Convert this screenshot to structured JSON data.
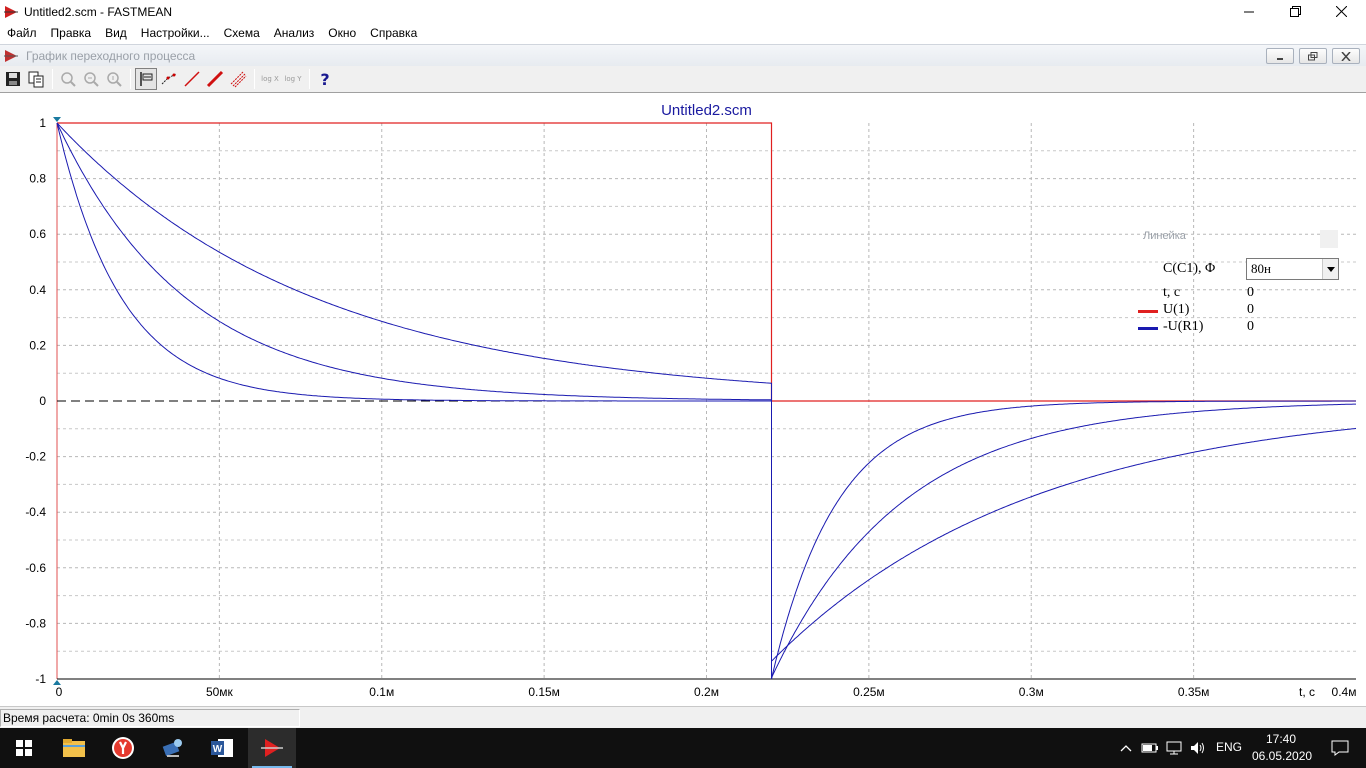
{
  "window": {
    "title": "Untitled2.scm - FASTMEAN"
  },
  "menu": [
    "Файл",
    "Правка",
    "Вид",
    "Настройки...",
    "Схема",
    "Анализ",
    "Окно",
    "Справка"
  ],
  "child_window": {
    "title": "График переходного процесса"
  },
  "toolbar": {
    "log_x": "log X",
    "log_y": "log Y",
    "help": "?"
  },
  "chart_data": {
    "type": "line",
    "title": "Untitled2.scm",
    "xlabel": "t, c",
    "x_unit_note": "seconds",
    "xlim": [
      0,
      0.0004
    ],
    "ylim": [
      -1,
      1
    ],
    "x_ticks": [
      {
        "value": 0,
        "label": "0"
      },
      {
        "value": 5e-05,
        "label": "50мк"
      },
      {
        "value": 0.0001,
        "label": "0.1м"
      },
      {
        "value": 0.00015,
        "label": "0.15м"
      },
      {
        "value": 0.0002,
        "label": "0.2м"
      },
      {
        "value": 0.00025,
        "label": "0.25м"
      },
      {
        "value": 0.0003,
        "label": "0.3м"
      },
      {
        "value": 0.00035,
        "label": "0.35м"
      },
      {
        "value": 0.0004,
        "label": "0.4м"
      }
    ],
    "y_ticks": [
      {
        "value": 1,
        "label": "1"
      },
      {
        "value": 0.8,
        "label": "0.8"
      },
      {
        "value": 0.6,
        "label": "0.6"
      },
      {
        "value": 0.4,
        "label": "0.4"
      },
      {
        "value": 0.2,
        "label": "0.2"
      },
      {
        "value": 0,
        "label": "0"
      },
      {
        "value": -0.2,
        "label": "-0.2"
      },
      {
        "value": -0.4,
        "label": "-0.4"
      },
      {
        "value": -0.6,
        "label": "-0.6"
      },
      {
        "value": -0.8,
        "label": "-0.8"
      },
      {
        "value": -1,
        "label": "-1"
      }
    ],
    "grid": true,
    "series": [
      {
        "name": "U(1)",
        "color": "#e02020",
        "points": [
          [
            0,
            1
          ],
          [
            0.00022,
            1
          ],
          [
            0.00022,
            0
          ],
          [
            0.0004,
            0
          ]
        ]
      },
      {
        "name": "-U(R1)",
        "color": "#1a1ab0",
        "step_time": 0.00022,
        "time_constants": [
          2e-05,
          4e-05,
          8e-05
        ],
        "points_tau_20u": [
          [
            0,
            1
          ],
          [
            5e-05,
            0.08
          ],
          [
            0.0001,
            0.007
          ],
          [
            0.00022,
            0.0
          ],
          [
            0.00022,
            -1
          ],
          [
            0.00025,
            -0.22
          ],
          [
            0.0003,
            -0.02
          ],
          [
            0.0004,
            0
          ]
        ],
        "points_tau_40u": [
          [
            0,
            1
          ],
          [
            5e-05,
            0.29
          ],
          [
            0.0001,
            0.08
          ],
          [
            0.00022,
            0.004
          ],
          [
            0.00022,
            -1
          ],
          [
            0.00025,
            -0.47
          ],
          [
            0.0003,
            -0.14
          ],
          [
            0.0004,
            -0.01
          ]
        ],
        "points_tau_80u": [
          [
            0,
            1
          ],
          [
            5e-05,
            0.53
          ],
          [
            0.0001,
            0.29
          ],
          [
            0.00022,
            0.064
          ],
          [
            0.00022,
            -1
          ],
          [
            0.00025,
            -0.69
          ],
          [
            0.0003,
            -0.37
          ],
          [
            0.0004,
            -0.105
          ]
        ]
      }
    ]
  },
  "ruler": {
    "title": "Линейка",
    "param_label": "C(C1), Φ",
    "param_value": "80н",
    "rows": [
      {
        "label": "t, c",
        "value": "0"
      },
      {
        "label": "U(1)",
        "value": "0",
        "color": "#e02020"
      },
      {
        "label": "-U(R1)",
        "value": "0",
        "color": "#1a1ab0"
      }
    ]
  },
  "status": {
    "text": "Время расчета: 0min 0s 360ms"
  },
  "taskbar": {
    "lang": "ENG",
    "time": "17:40",
    "date": "06.05.2020"
  }
}
